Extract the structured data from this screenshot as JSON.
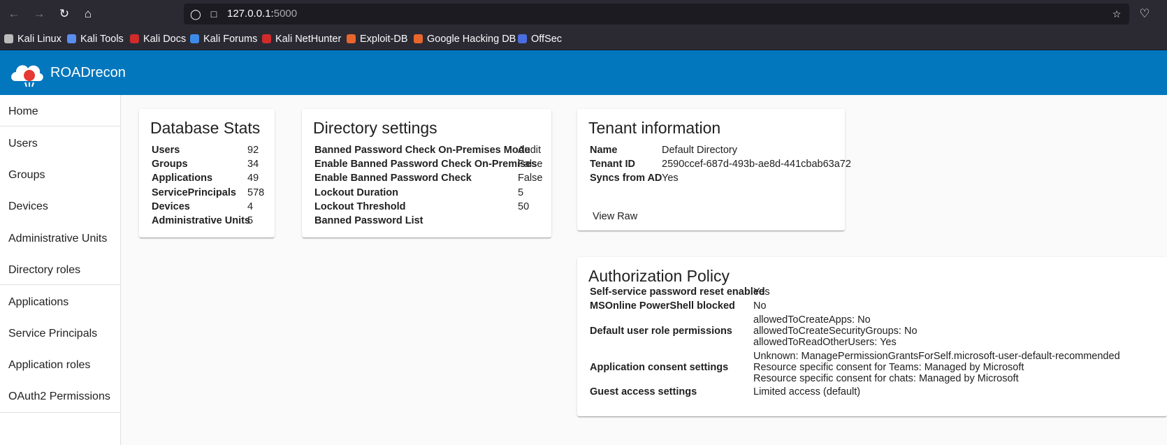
{
  "browser": {
    "url_host": "127.0.0.1:",
    "url_port": "5000",
    "bookmarks": [
      {
        "label": "Kali Linux",
        "color": "#bbbbbb"
      },
      {
        "label": "Kali Tools",
        "color": "#5a8dee"
      },
      {
        "label": "Kali Docs",
        "color": "#d12b2b"
      },
      {
        "label": "Kali Forums",
        "color": "#3d8be8"
      },
      {
        "label": "Kali NetHunter",
        "color": "#d12b2b"
      },
      {
        "label": "Exploit-DB",
        "color": "#e8662c"
      },
      {
        "label": "Google Hacking DB",
        "color": "#e8662c"
      },
      {
        "label": "OffSec",
        "color": "#4a6ee0"
      }
    ]
  },
  "app": {
    "title": "ROADrecon",
    "header_color": "#0277bd"
  },
  "sidebar": {
    "items": [
      "Home",
      "Users",
      "Groups",
      "Devices",
      "Administrative Units",
      "Directory roles",
      "Applications",
      "Service Principals",
      "Application roles",
      "OAuth2 Permissions"
    ]
  },
  "database_stats": {
    "title": "Database Stats",
    "rows": [
      {
        "label": "Users",
        "value": "92"
      },
      {
        "label": "Groups",
        "value": "34"
      },
      {
        "label": "Applications",
        "value": "49"
      },
      {
        "label": "ServicePrincipals",
        "value": "578"
      },
      {
        "label": "Devices",
        "value": "4"
      },
      {
        "label": "Administrative Units",
        "value": "5"
      }
    ]
  },
  "directory_settings": {
    "title": "Directory settings",
    "rows": [
      {
        "label": "Banned Password Check On-Premises Mode",
        "value": "Audit"
      },
      {
        "label": "Enable Banned Password Check On-Premises",
        "value": "False"
      },
      {
        "label": "Enable Banned Password Check",
        "value": "False"
      },
      {
        "label": "Lockout Duration",
        "value": "5"
      },
      {
        "label": "Lockout Threshold",
        "value": "50"
      },
      {
        "label": "Banned Password List",
        "value": ""
      }
    ]
  },
  "tenant_information": {
    "title": "Tenant information",
    "rows": [
      {
        "label": "Name",
        "value": "Default Directory"
      },
      {
        "label": "Tenant ID",
        "value": "2590ccef-687d-493b-ae8d-441cbab63a72"
      },
      {
        "label": "Syncs from AD",
        "value": "Yes"
      }
    ],
    "view_raw_label": "View Raw"
  },
  "authorization_policy": {
    "title": "Authorization Policy",
    "rows": [
      {
        "label": "Self-service password reset enabled",
        "lines": [
          "Yes"
        ]
      },
      {
        "label": "MSOnline PowerShell blocked",
        "lines": [
          "No"
        ]
      },
      {
        "label": "Default user role permissions",
        "lines": [
          "allowedToCreateApps: No",
          "allowedToCreateSecurityGroups: No",
          "allowedToReadOtherUsers: Yes"
        ]
      },
      {
        "label": "Application consent settings",
        "lines": [
          "Unknown: ManagePermissionGrantsForSelf.microsoft-user-default-recommended",
          "Resource specific consent for Teams: Managed by Microsoft",
          "Resource specific consent for chats: Managed by Microsoft"
        ]
      },
      {
        "label": "Guest access settings",
        "lines": [
          "Limited access (default)"
        ]
      }
    ]
  }
}
